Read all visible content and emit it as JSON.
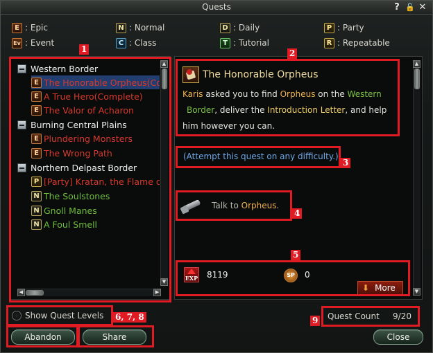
{
  "window": {
    "title": "Quests"
  },
  "titlebar_buttons": [
    {
      "icon": "help-icon",
      "glyph": "?"
    },
    {
      "icon": "lock-icon",
      "glyph": "🔓"
    },
    {
      "icon": "close-icon",
      "glyph": "✕"
    }
  ],
  "legend": [
    {
      "badge": "E",
      "label": ": Epic",
      "kind": "e"
    },
    {
      "badge": "N",
      "label": ": Normal",
      "kind": "n"
    },
    {
      "badge": "D",
      "label": ": Daily",
      "kind": "d"
    },
    {
      "badge": "P",
      "label": ": Party",
      "kind": "p"
    },
    {
      "badge": "Ev",
      "label": ": Event",
      "kind": "ev"
    },
    {
      "badge": "C",
      "label": ": Class",
      "kind": "c"
    },
    {
      "badge": "T",
      "label": ": Tutorial",
      "kind": "t"
    },
    {
      "badge": "R",
      "label": ": Repeatable",
      "kind": "r"
    }
  ],
  "annotations": {
    "n1": "1",
    "n2": "2",
    "n3": "3",
    "n4": "4",
    "n5": "5",
    "n678": "6, 7, 8",
    "n9": "9"
  },
  "tree": [
    {
      "type": "category",
      "label": "Western Border"
    },
    {
      "type": "quest",
      "badge": "E",
      "label": "The Honorable Orpheus(Co",
      "color": "red",
      "selected": true
    },
    {
      "type": "quest",
      "badge": "E",
      "label": "A True Hero(Complete)",
      "color": "red"
    },
    {
      "type": "quest",
      "badge": "E",
      "label": "The Valor of Acharon",
      "color": "red"
    },
    {
      "type": "category",
      "label": "Burning Central Plains"
    },
    {
      "type": "quest",
      "badge": "E",
      "label": "Plundering Monsters",
      "color": "red"
    },
    {
      "type": "quest",
      "badge": "E",
      "label": "The Wrong Path",
      "color": "red"
    },
    {
      "type": "category",
      "label": "Northern Delpast Border"
    },
    {
      "type": "quest",
      "badge": "P",
      "label": "[Party] Kratan, the Flame o",
      "color": "red"
    },
    {
      "type": "quest",
      "badge": "N",
      "label": "The Soulstones",
      "color": "green"
    },
    {
      "type": "quest",
      "badge": "N",
      "label": "Gnoll Manes",
      "color": "green"
    },
    {
      "type": "quest",
      "badge": "N",
      "label": "A Foul Smell",
      "color": "green"
    }
  ],
  "detail": {
    "title": "The Honorable Orpheus",
    "desc": {
      "p1": "Karis",
      "p2": " asked you to find ",
      "p3": "Orpheus",
      "p4": " on the ",
      "p5": "Western",
      "p6": "Border",
      "p7": ", deliver the ",
      "p8": "Introduction Letter",
      "p9": ", and help",
      "p10": "him however you can."
    },
    "attempt": "(Attempt this quest on any difficulty.)",
    "objective": {
      "prefix": "Talk to ",
      "target": "Orpheus",
      "suffix": "."
    }
  },
  "rewards": {
    "exp_icon": "EXP",
    "exp": "8119",
    "sp_icon": "SP",
    "sp": "0",
    "more_label": "More"
  },
  "footer": {
    "show_levels": "Show Quest Levels",
    "abandon": "Abandon",
    "share": "Share",
    "close": "Close",
    "quest_count_label": "Quest Count",
    "quest_count_value": "9/20"
  }
}
